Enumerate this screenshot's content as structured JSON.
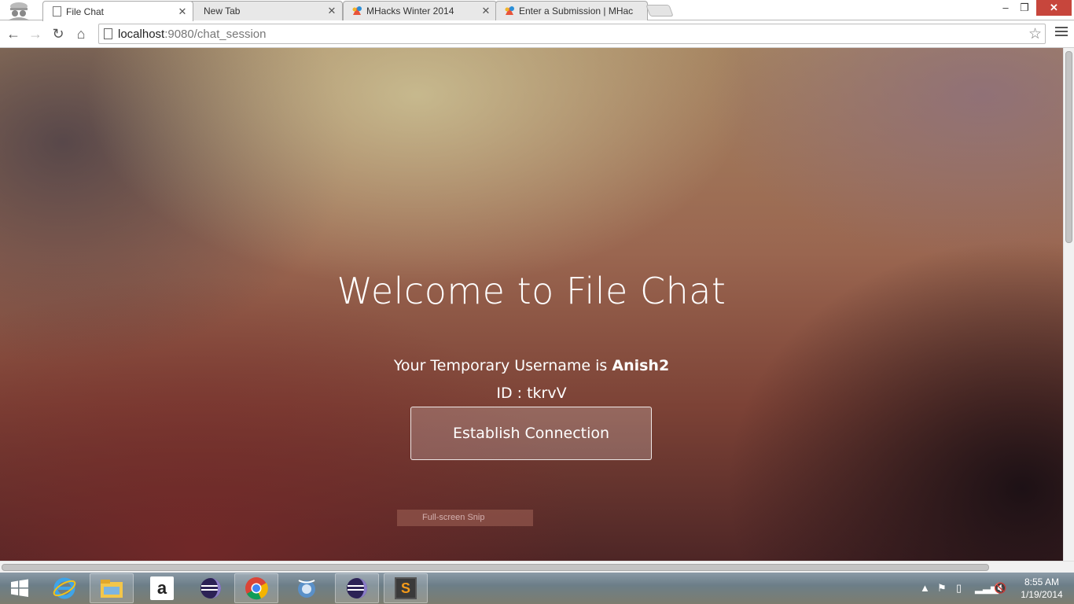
{
  "browser": {
    "tabs": [
      {
        "label": "File Chat",
        "active": true
      },
      {
        "label": "New Tab",
        "active": false
      },
      {
        "label": "MHacks Winter 2014",
        "active": false
      },
      {
        "label": "Enter a Submission | MHac",
        "active": false
      }
    ],
    "url_host": "localhost",
    "url_rest": ":9080/chat_session"
  },
  "page": {
    "heading": "Welcome to File Chat",
    "username_prefix": "Your Temporary Username is ",
    "username": "Anish2",
    "id_line": "ID : tkrvV",
    "connect_button": "Establish Connection",
    "snip_overlay": "Full-screen Snip"
  },
  "taskbar": {
    "apps": [
      "start-icon",
      "internet-explorer-icon",
      "file-explorer-icon",
      "amazon-icon",
      "eclipse-icon",
      "chrome-icon",
      "media-icon",
      "eclipse-icon",
      "sublime-text-icon"
    ],
    "time": "8:55 AM",
    "date": "1/19/2014"
  }
}
